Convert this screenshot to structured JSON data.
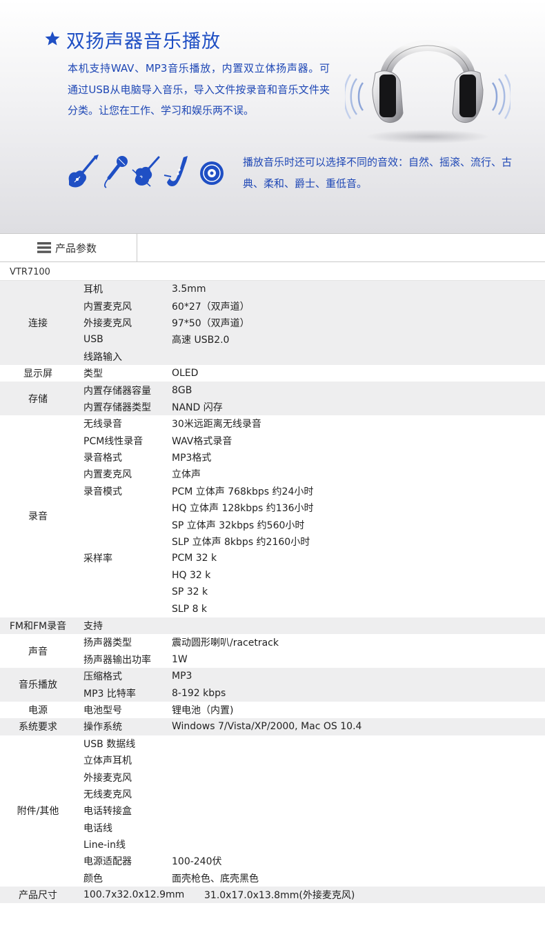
{
  "hero": {
    "title": "双扬声器音乐播放",
    "description": "本机支持WAV、MP3音乐播放，内置双立体扬声器。可通过USB从电脑导入音乐，导入文件按录音和音乐文件夹分类。让您在工作、学习和娱乐两不误。",
    "effects": "播放音乐时还可以选择不同的音效：自然、摇滚、流行、古典、柔和、爵士、重低音。",
    "icons": [
      "electric-guitar-icon",
      "microphone-icon",
      "violin-icon",
      "saxophone-icon",
      "disc-icon",
      "headphone-icon"
    ],
    "accent_color": "#1f4fc4"
  },
  "section": {
    "title": "产品参数"
  },
  "model": "VTR7100",
  "spec_groups": [
    {
      "category": "连接",
      "rows": [
        {
          "label": "耳机",
          "value": "3.5mm"
        },
        {
          "label": "内置麦克风",
          "value": "60*27（双声道）"
        },
        {
          "label": "外接麦克风",
          "value": "97*50（双声道）"
        },
        {
          "label": "USB",
          "value": "高速 USB2.0"
        },
        {
          "label": "线路输入",
          "value": ""
        }
      ]
    },
    {
      "category": "显示屏",
      "rows": [
        {
          "label": "类型",
          "value": "OLED"
        }
      ]
    },
    {
      "category": "存储",
      "rows": [
        {
          "label": "内置存储器容量",
          "value": "8GB"
        },
        {
          "label": "内置存储器类型",
          "value": "NAND 闪存"
        }
      ]
    },
    {
      "category": "录音",
      "rows": [
        {
          "label": "无线录音",
          "value": "30米远距离无线录音"
        },
        {
          "label": "PCM线性录音",
          "value": "WAV格式录音"
        },
        {
          "label": "录音格式",
          "value": "MP3格式"
        },
        {
          "label": "内置麦克风",
          "value": "立体声"
        },
        {
          "label": "录音模式",
          "value": "PCM 立体声  768kbps  约24小时"
        },
        {
          "label": "",
          "value": "HQ 立体声  128kbps  约136小时"
        },
        {
          "label": "",
          "value": "SP 立体声    32kbps  约560小时"
        },
        {
          "label": "",
          "value": "SLP 立体声  8kbps  约2160小时"
        },
        {
          "label": "采样率",
          "value": "PCM     32 k"
        },
        {
          "label": "",
          "value": "HQ       32 k"
        },
        {
          "label": "",
          "value": "SP       32 k"
        },
        {
          "label": "",
          "value": "SLP      8 k"
        }
      ]
    },
    {
      "category": "FM和FM录音",
      "rows": [
        {
          "label": "支持",
          "value": ""
        }
      ]
    },
    {
      "category": "声音",
      "rows": [
        {
          "label": "扬声器类型",
          "value": "震动圆形喇叭/racetrack"
        },
        {
          "label": "扬声器输出功率",
          "value": "1W"
        }
      ]
    },
    {
      "category": "音乐播放",
      "rows": [
        {
          "label": "压缩格式",
          "value": "MP3"
        },
        {
          "label": "MP3 比特率",
          "value": "8-192 kbps"
        }
      ]
    },
    {
      "category": "电源",
      "rows": [
        {
          "label": "电池型号",
          "value": "锂电池（内置)"
        }
      ]
    },
    {
      "category": "系统要求",
      "rows": [
        {
          "label": "操作系统",
          "value": "Windows 7/Vista/XP/2000, Mac OS 10.4"
        }
      ]
    },
    {
      "category": "附件/其他",
      "rows": [
        {
          "label": "USB 数据线",
          "value": ""
        },
        {
          "label": "立体声耳机",
          "value": ""
        },
        {
          "label": "外接麦克风",
          "value": ""
        },
        {
          "label": "无线麦克风",
          "value": ""
        },
        {
          "label": "电话转接盒",
          "value": ""
        },
        {
          "label": "电话线",
          "value": ""
        },
        {
          "label": "Line-in线",
          "value": ""
        },
        {
          "label": "电源适配器",
          "value": "100-240伏"
        },
        {
          "label": "颜色",
          "value": "面壳枪色、底壳黑色"
        }
      ]
    }
  ],
  "dimensions": {
    "category": "产品尺寸",
    "main": "100.7x32.0x12.9mm",
    "mic": "31.0x17.0x13.8mm(外接麦克风)"
  }
}
